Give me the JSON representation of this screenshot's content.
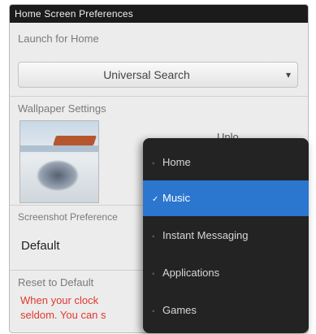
{
  "window": {
    "title": "Home Screen Preferences"
  },
  "launch": {
    "section_label": "Launch for Home",
    "selected": "Universal Search",
    "arrow": "▾"
  },
  "wallpaper": {
    "section_label": "Wallpaper Settings",
    "visible_partial": "Unlo"
  },
  "orientation": {
    "section_label": "Screenshot Preference",
    "value": "Default"
  },
  "reset": {
    "label": "Reset to Default",
    "hint_line1": "When your clock",
    "hint_line2": "seldom. You can s"
  },
  "menu": {
    "items": [
      {
        "label": "Home",
        "marker": "◦",
        "active": false
      },
      {
        "label": "Music",
        "marker": "✓",
        "active": true
      },
      {
        "label": "Instant Messaging",
        "marker": "◦",
        "active": false
      },
      {
        "label": "Applications",
        "marker": "◦",
        "active": false
      },
      {
        "label": "Games",
        "marker": "◦",
        "active": false
      }
    ]
  },
  "colors": {
    "titlebar_bg": "#1b1b1b",
    "menu_bg": "#232323",
    "accent": "#2b76cf",
    "hint_red": "#e0392f"
  }
}
